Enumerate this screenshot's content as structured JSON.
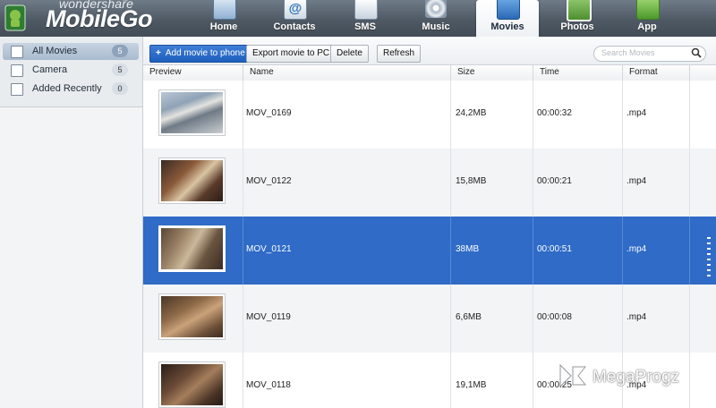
{
  "brand": {
    "company": "wondershare",
    "product": "MobileGo",
    "tm": "™"
  },
  "nav": {
    "tabs": [
      {
        "label": "Home",
        "icon": "home-icon"
      },
      {
        "label": "Contacts",
        "icon": "contacts-icon",
        "glyph": "@"
      },
      {
        "label": "SMS",
        "icon": "sms-icon"
      },
      {
        "label": "Music",
        "icon": "music-icon"
      },
      {
        "label": "Movies",
        "icon": "movies-icon",
        "active": true
      },
      {
        "label": "Photos",
        "icon": "photos-icon"
      },
      {
        "label": "App",
        "icon": "app-icon"
      }
    ]
  },
  "sidebar": {
    "items": [
      {
        "label": "All Movies",
        "count": "5",
        "icon": "film-icon",
        "active": true
      },
      {
        "label": "Camera",
        "count": "5",
        "icon": "camera-icon"
      },
      {
        "label": "Added Recently",
        "count": "0",
        "icon": "recent-icon"
      }
    ]
  },
  "toolbar": {
    "add_label": "Add movie to phone",
    "add_glyph": "+",
    "export_label": "Export movie to PC",
    "delete_label": "Delete",
    "refresh_label": "Refresh",
    "search_placeholder": "Search Movies"
  },
  "table": {
    "columns": [
      "Preview",
      "Name",
      "Size",
      "Time",
      "Format"
    ],
    "rows": [
      {
        "name": "MOV_0169",
        "size": "24,2MB",
        "time": "00:00:32",
        "format": ".mp4",
        "selected": false
      },
      {
        "name": "MOV_0122",
        "size": "15,8MB",
        "time": "00:00:21",
        "format": ".mp4",
        "selected": false
      },
      {
        "name": "MOV_0121",
        "size": "38MB",
        "time": "00:00:51",
        "format": ".mp4",
        "selected": true
      },
      {
        "name": "MOV_0119",
        "size": "6,6MB",
        "time": "00:00:08",
        "format": ".mp4",
        "selected": false
      },
      {
        "name": "MOV_0118",
        "size": "19,1MB",
        "time": "00:00:25",
        "format": ".mp4",
        "selected": false
      }
    ]
  },
  "watermark": {
    "text": "MegaProgz"
  },
  "colors": {
    "accent": "#2f6bc7",
    "topbar": "#4e5964",
    "sidebar": "#f3f4f6"
  }
}
